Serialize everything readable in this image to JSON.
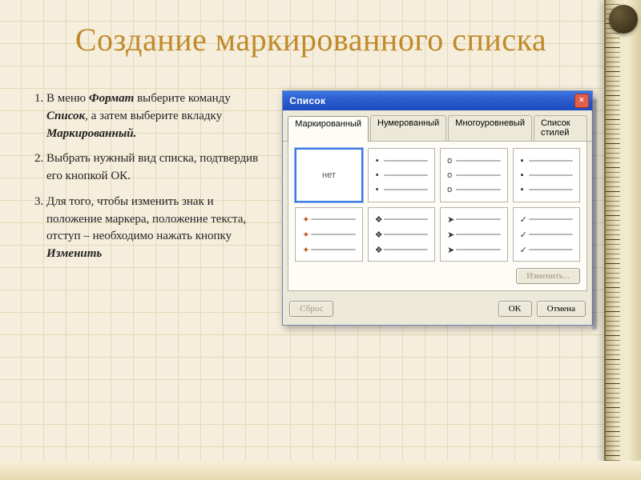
{
  "slide": {
    "title": "Создание маркированного списка",
    "steps": [
      {
        "pre": "В меню ",
        "em1": "Формат",
        "mid1": " выберите команду ",
        "em2": "Список",
        "mid2": ", а затем выберите вкладку ",
        "em3": "Маркированный."
      },
      {
        "text": "Выбрать нужный вид списка, подтвердив его кнопкой ОК."
      },
      {
        "pre": "Для того, чтобы изменить знак и положение маркера, положение текста, отступ – необходимо нажать кнопку ",
        "em1": "Изменить"
      }
    ]
  },
  "dialog": {
    "title": "Список",
    "close": "×",
    "tabs": [
      "Маркированный",
      "Нумерованный",
      "Многоуровневый",
      "Список стилей"
    ],
    "active_tab": 0,
    "none_label": "нет",
    "markers_row1": [
      "",
      "•",
      "o",
      "▪"
    ],
    "markers_row2": [
      "✦",
      "❖",
      "➤",
      "✓"
    ],
    "buttons": {
      "reset": "Сброс",
      "change": "Изменить...",
      "ok": "OK",
      "cancel": "Отмена"
    }
  }
}
